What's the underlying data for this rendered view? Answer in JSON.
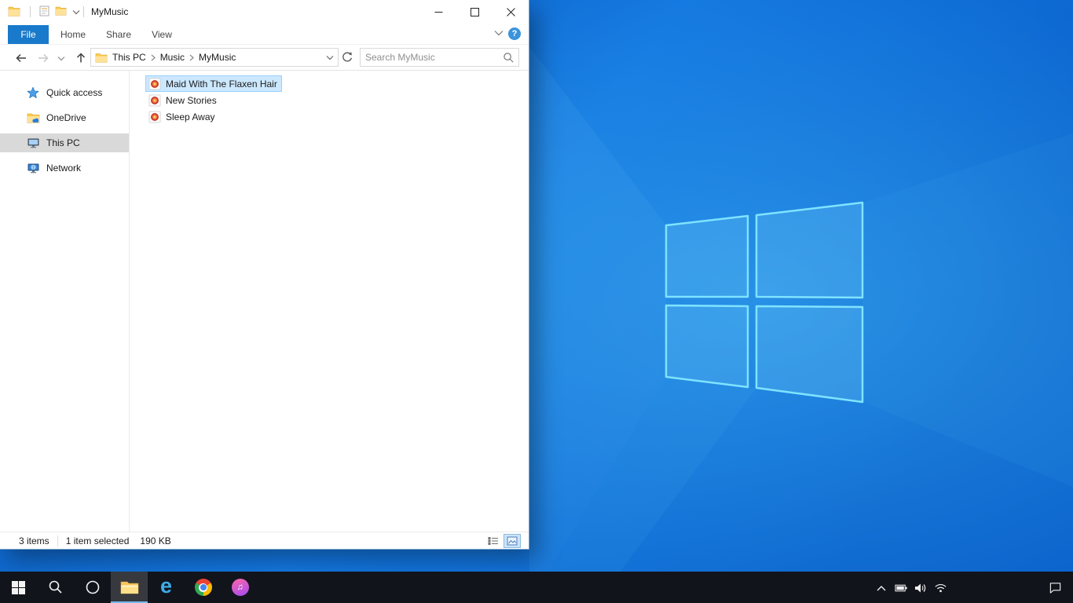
{
  "explorer": {
    "title": "MyMusic",
    "ribbon": {
      "file_tab": "File",
      "tabs": [
        "Home",
        "Share",
        "View"
      ],
      "help_label": "?"
    },
    "navbar": {
      "breadcrumb": [
        "This PC",
        "Music",
        "MyMusic"
      ],
      "search_placeholder": "Search MyMusic"
    },
    "sidebar": {
      "items": [
        {
          "label": "Quick access",
          "icon": "star-icon",
          "selected": false
        },
        {
          "label": "OneDrive",
          "icon": "onedrive-icon",
          "selected": false
        },
        {
          "label": "This PC",
          "icon": "computer-icon",
          "selected": true
        },
        {
          "label": "Network",
          "icon": "network-icon",
          "selected": false
        }
      ]
    },
    "files": {
      "items": [
        {
          "name": "Maid With The Flaxen Hair",
          "icon": "media-file-icon",
          "selected": true
        },
        {
          "name": "New Stories",
          "icon": "media-file-icon",
          "selected": false
        },
        {
          "name": "Sleep Away",
          "icon": "media-file-icon",
          "selected": false
        }
      ]
    },
    "statusbar": {
      "count": "3 items",
      "selection": "1 item selected",
      "size": "190 KB"
    }
  },
  "taskbar": {
    "edge_glyph": "e",
    "itunes_glyph": "♫",
    "icons": [
      "start",
      "search",
      "cortana",
      "file-explorer",
      "edge",
      "chrome",
      "itunes"
    ],
    "tray_icons": [
      "tray-expand",
      "battery",
      "volume",
      "wifi",
      "action-center"
    ]
  },
  "colors": {
    "accent": "#1979ca",
    "selection_fill": "#cce8ff",
    "selection_border": "#99d1ff",
    "taskbar_bg": "#11141b",
    "wallpaper_logo": "#7fe3ff"
  }
}
